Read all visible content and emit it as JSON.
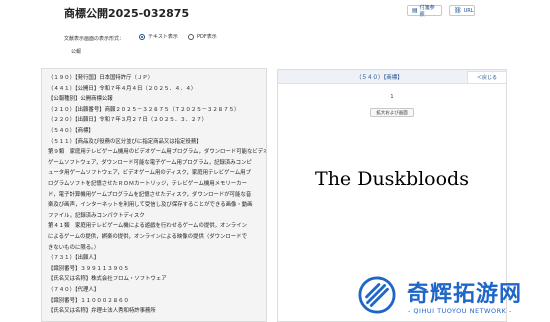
{
  "page": {
    "title": "商標公開2025-032875"
  },
  "top_buttons": {
    "sticky": "付箋参照",
    "url": "URL"
  },
  "display_mode": {
    "label": "文献表示画面の表示形式：",
    "text_option": "テキスト表示",
    "pdf_option": "PDF表示",
    "selected": "text"
  },
  "section_label": "公報",
  "document_lines": [
    "（１９０）【発行国】日本国特許庁（ＪＰ）",
    "（４４１）【公開日】令和７年４月４日（２０２５．４．４）",
    "【公報種別】公開商標公報",
    "（２１０）【出願番号】商願２０２５－３２８７５（Ｔ２０２５－３２８７５）",
    "（２２０）【出願日】令和７年３月２７日（２０２５．３．２７）",
    "（５４０）【商標】",
    "（５１１）【商品及び役務の区分並びに指定商品又は指定役務】",
    "第９類　家庭用テレビゲーム機用のビデオゲーム用プログラム，ダウンロード可能なビデオ",
    "ゲームソフトウェア，ダウンロード可能な電子ゲーム用プログラム，記録済みコンピ",
    "ュータ用ゲームソフトウェア，ビデオゲーム用のディスク，家庭用テレビゲーム用プ",
    "ログラムソフトを記憶させたＲＯＭカートリッジ，テレビゲーム機用メモリーカー",
    "ド，電子計算機用ゲームプログラムを記憶させたディスク，ダウンロードが可能な音",
    "楽及び画声，インターネットを利用して受信し及び保存することができる画像・動画",
    "ファイル，記録済みコンパクトディスク",
    "第４１類　家庭用テレビゲーム機による遊戯を行わせるゲームの提供，オンライン",
    "によるゲームの提供，娯楽の提供，オンラインによる映像の提供（ダウンロードで",
    "きないものに限る。）",
    "（７３１）【出願人】",
    "【識別番号】３９９１１３９０５",
    "【氏名又は名称】株式会社フロム・ソフトウェア",
    "（７４０）【代理人】",
    "【識別番号】１１０００２８６０",
    "【氏名又は名称】弁理士法人秀和特許事務所"
  ],
  "mark_panel": {
    "code": "（５４０）【商標】",
    "back": "＜戻じる",
    "page_number": "1",
    "zoom_label": "拡大および画面",
    "mark_text": "The Duskbloods"
  },
  "watermark": {
    "cn": "奇辉拓游网",
    "en": "- QIHUI TUOYOU NETWORK -"
  },
  "colors": {
    "accent": "#1a4d8f",
    "watermark": "#1f66c8"
  }
}
